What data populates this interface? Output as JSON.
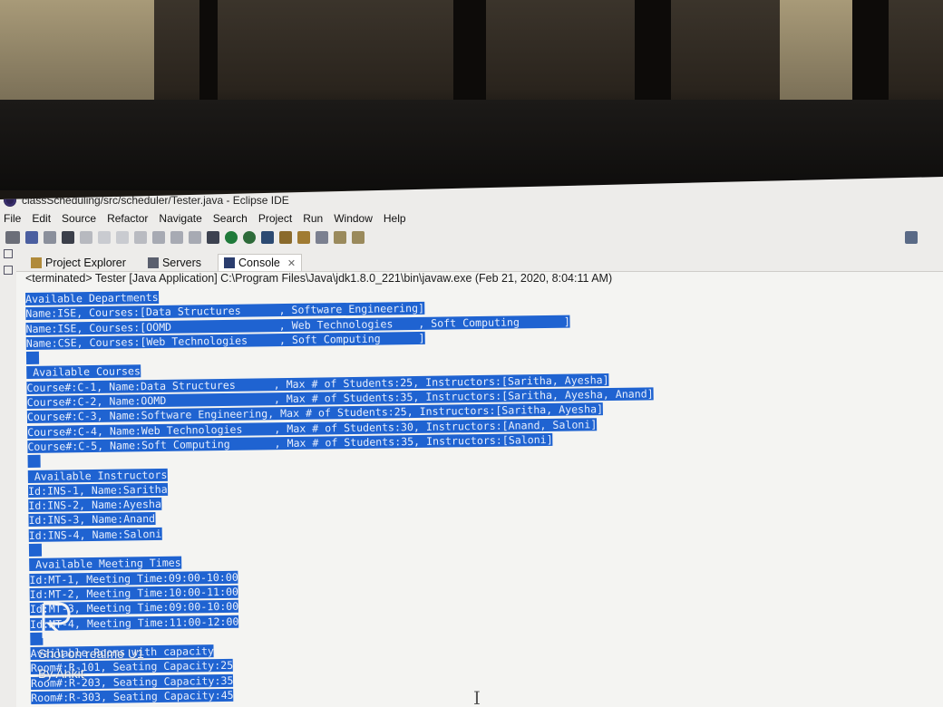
{
  "window": {
    "title": "classScheduling/src/scheduler/Tester.java - Eclipse IDE"
  },
  "menu": {
    "items": [
      "File",
      "Edit",
      "Source",
      "Refactor",
      "Navigate",
      "Search",
      "Project",
      "Run",
      "Window",
      "Help"
    ]
  },
  "toolbar": {
    "icons": [
      "new-icon",
      "save-icon",
      "save-all-icon",
      "terminal-icon",
      "skip-breakpoints-icon",
      "resume-icon",
      "suspend-icon",
      "terminate-icon",
      "step-into-icon",
      "step-over-icon",
      "step-return-icon",
      "debug-icon",
      "run-icon",
      "coverage-icon",
      "external-tools-icon",
      "open-type-icon",
      "open-task-icon",
      "search-icon",
      "back-icon",
      "forward-icon",
      "open-perspective-icon"
    ]
  },
  "tabs": [
    {
      "label": "Project Explorer",
      "icon": "project-explorer-icon"
    },
    {
      "label": "Servers",
      "icon": "servers-icon"
    },
    {
      "label": "Console",
      "icon": "console-icon",
      "active": true
    }
  ],
  "console": {
    "header": "<terminated> Tester [Java Application] C:\\Program Files\\Java\\jdk1.8.0_221\\bin\\javaw.exe (Feb 21, 2020, 8:04:11 AM)",
    "lines": [
      "Available Departments",
      "Name:ISE, Courses:[Data Structures      , Software Engineering]",
      "Name:ISE, Courses:[OOMD                 , Web Technologies    , Soft Computing       ]",
      "Name:CSE, Courses:[Web Technologies     , Soft Computing      ]",
      "",
      " Available Courses",
      "Course#:C-1, Name:Data Structures      , Max # of Students:25, Instructors:[Saritha, Ayesha]",
      "Course#:C-2, Name:OOMD                 , Max # of Students:35, Instructors:[Saritha, Ayesha, Anand]",
      "Course#:C-3, Name:Software Engineering, Max # of Students:25, Instructors:[Saritha, Ayesha]",
      "Course#:C-4, Name:Web Technologies     , Max # of Students:30, Instructors:[Anand, Saloni]",
      "Course#:C-5, Name:Soft Computing       , Max # of Students:35, Instructors:[Saloni]",
      "",
      " Available Instructors",
      "Id:INS-1, Name:Saritha",
      "Id:INS-2, Name:Ayesha",
      "Id:INS-3, Name:Anand",
      "Id:INS-4, Name:Saloni",
      "",
      " Available Meeting Times",
      "Id:MT-1, Meeting Time:09:00-10:00",
      "Id:MT-2, Meeting Time:10:00-11:00",
      "Id:MT-3, Meeting Time:09:00-10:00",
      "Id:MT-4, Meeting Time:11:00-12:00",
      "",
      "Available Rooms with capacity",
      "Room#:R-101, Seating Capacity:25",
      "Room#:R-203, Seating Capacity:35",
      "Room#:R-303, Seating Capacity:45"
    ]
  },
  "watermark": {
    "line1": "Shot on realme U1",
    "line2": "By Ankit"
  }
}
